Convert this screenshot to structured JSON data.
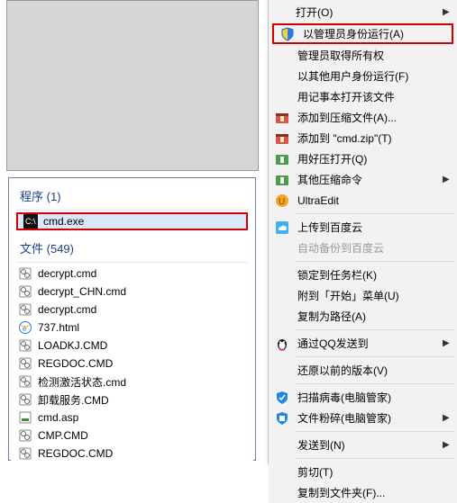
{
  "menu": {
    "open": "打开(O)",
    "run_as_admin": "以管理员身份运行(A)",
    "admin_take_ownership": "管理员取得所有权",
    "run_as_other_user": "以其他用户身份运行(F)",
    "open_with_notepad": "用记事本打开该文件",
    "add_to_archive": "添加到压缩文件(A)...",
    "add_to_zip": "添加到 \"cmd.zip\"(T)",
    "open_with_haozip": "用好压打开(Q)",
    "other_compress": "其他压缩命令",
    "ultraedit": "UltraEdit",
    "upload_baidu": "上传到百度云",
    "auto_backup_baidu": "自动备份到百度云",
    "pin_taskbar": "锁定到任务栏(K)",
    "pin_start": "附到「开始」菜单(U)",
    "copy_as_path": "复制为路径(A)",
    "send_via_qq": "通过QQ发送到",
    "restore_previous": "还原以前的版本(V)",
    "scan_virus": "扫描病毒(电脑管家)",
    "file_shred": "文件粉碎(电脑管家)",
    "send_to": "发送到(N)",
    "cut": "剪切(T)",
    "copy_to_folder": "复制到文件夹(F)..."
  },
  "search": {
    "programs_header": "程序",
    "programs_count": "(1)",
    "program_item": "cmd.exe",
    "files_header": "文件",
    "files_count": "(549)",
    "files": [
      "decrypt.cmd",
      "decrypt_CHN.cmd",
      "decrypt.cmd",
      "737.html",
      "LOADKJ.CMD",
      "REGDOC.CMD",
      "检测激活状态.cmd",
      "卸载服务.CMD",
      "cmd.asp",
      "CMP.CMD",
      "REGDOC.CMD"
    ]
  },
  "icons": {
    "shield": "shield",
    "archive": "archive",
    "haozip": "haozip",
    "ultraedit": "ultraedit",
    "baidu": "baidu",
    "qq": "qq",
    "guard": "guard",
    "console": "console",
    "gear": "gear",
    "ie": "ie",
    "asp": "asp"
  }
}
